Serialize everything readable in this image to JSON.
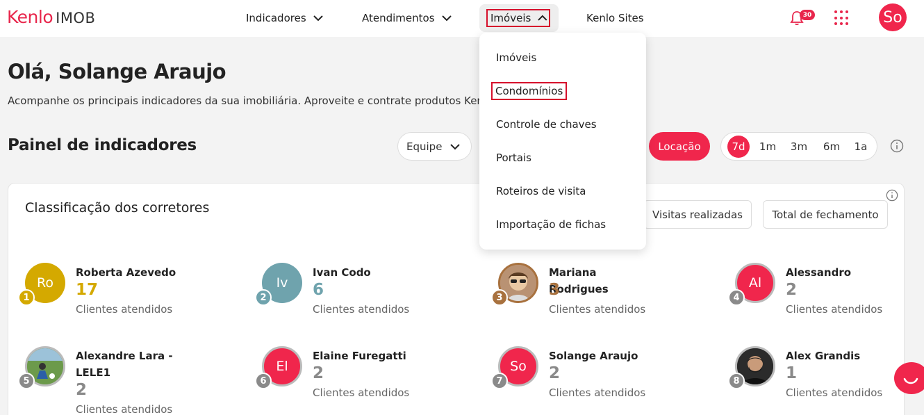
{
  "header": {
    "logo_brand": "Kenlo",
    "logo_product": "IMOB",
    "nav": [
      {
        "label": "Indicadores"
      },
      {
        "label": "Atendimentos"
      },
      {
        "label": "Imóveis"
      },
      {
        "label": "Kenlo Sites"
      }
    ],
    "notifications_count": "30",
    "user_initials": "So"
  },
  "dropdown": {
    "items": [
      {
        "label": "Imóveis"
      },
      {
        "label": "Condomínios"
      },
      {
        "label": "Controle de chaves"
      },
      {
        "label": "Portais"
      },
      {
        "label": "Roteiros de visita"
      },
      {
        "label": "Importação de fichas"
      }
    ]
  },
  "greeting": {
    "title": "Olá, Solange Araujo",
    "subtitle": "Acompanhe os principais indicadores da sua imobiliária. Aproveite e contrate produtos Kenlo e fa"
  },
  "panel": {
    "title": "Painel de indicadores",
    "team_filter": "Equipe",
    "business_type": "Locação",
    "periods": [
      "7d",
      "1m",
      "3m",
      "6m",
      "1a"
    ],
    "active_period": "7d"
  },
  "ranking": {
    "title": "Classificação dos corretores",
    "tabs": [
      "Visitas realizadas",
      "Total de fechamento"
    ],
    "brokers": [
      {
        "rank": "1",
        "initials": "Ro",
        "name": "Roberta Azevedo",
        "count": "17",
        "label": "Clientes atendidos",
        "color": "#d4a900"
      },
      {
        "rank": "2",
        "initials": "Iv",
        "name": "Ivan Codo",
        "count": "6",
        "label": "Clientes atendidos",
        "color": "#6fa3ad"
      },
      {
        "rank": "3",
        "initials": "",
        "name": "Mariana Rodrigues",
        "count": "3",
        "label": "Clientes atendidos",
        "color": "#a8713e"
      },
      {
        "rank": "4",
        "initials": "Al",
        "name": "Alessandro",
        "count": "2",
        "label": "Clientes atendidos",
        "color": "#8a8a8a"
      },
      {
        "rank": "5",
        "initials": "",
        "name": "Alexandre Lara - LELE1",
        "count": "2",
        "label": "Clientes atendidos",
        "color": "#8a8a8a"
      },
      {
        "rank": "6",
        "initials": "El",
        "name": "Elaine Furegatti",
        "count": "2",
        "label": "Clientes atendidos",
        "color": "#8a8a8a"
      },
      {
        "rank": "7",
        "initials": "So",
        "name": "Solange Araujo",
        "count": "2",
        "label": "Clientes atendidos",
        "color": "#8a8a8a"
      },
      {
        "rank": "8",
        "initials": "",
        "name": "Alex Grandis",
        "count": "1",
        "label": "Clientes atendidos",
        "color": "#8a8a8a"
      }
    ]
  },
  "colors": {
    "accent": "#f0264c",
    "highlight_border": "#d6102c"
  }
}
